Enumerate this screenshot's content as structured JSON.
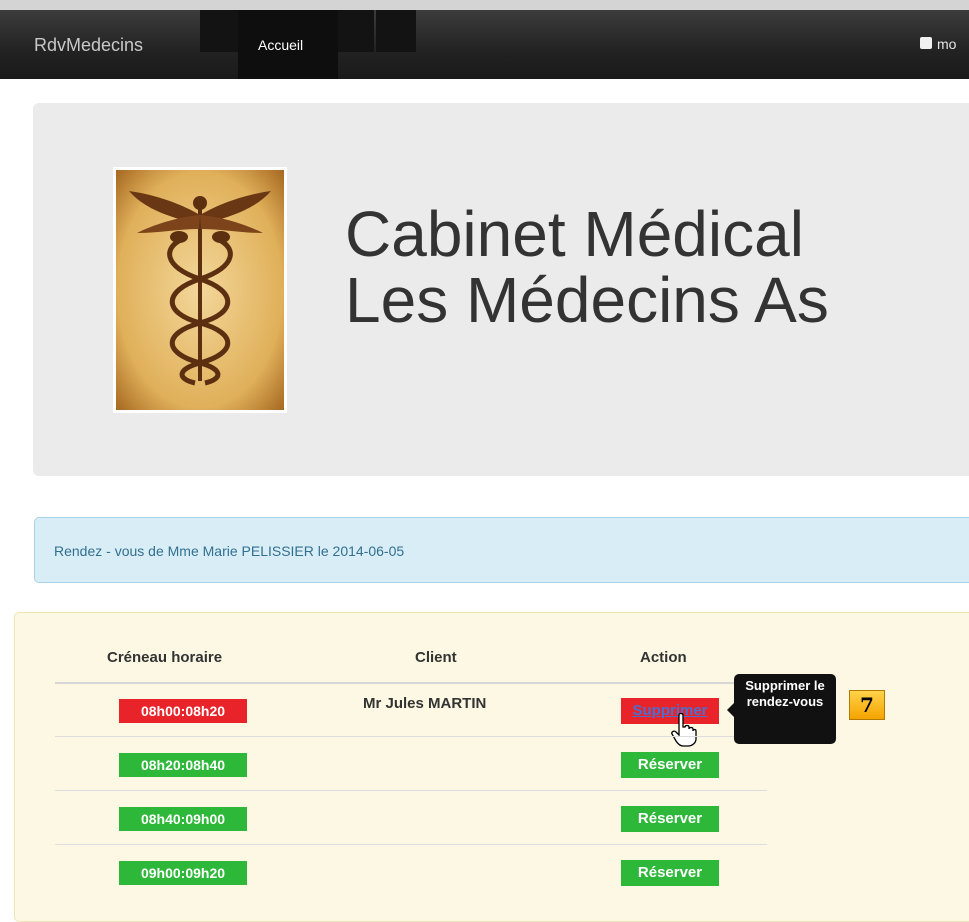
{
  "navbar": {
    "brand": "RdvMedecins",
    "nav_label": "Accueil",
    "right_text": "mo"
  },
  "jumbotron": {
    "title_line1": "Cabinet Médical",
    "title_line2": "Les Médecins As",
    "logo_icon": "caduceus-icon"
  },
  "alert": {
    "text": "Rendez - vous de Mme Marie PELISSIER le 2014-06-05"
  },
  "table": {
    "headers": [
      "Créneau horaire",
      "Client",
      "Action"
    ],
    "rows": [
      {
        "slot": "08h00:08h20",
        "client": "Mr Jules MARTIN",
        "action": "Supprimer",
        "status": "booked"
      },
      {
        "slot": "08h20:08h40",
        "client": "",
        "action": "Réserver",
        "status": "free"
      },
      {
        "slot": "08h40:09h00",
        "client": "",
        "action": "Réserver",
        "status": "free"
      },
      {
        "slot": "09h00:09h20",
        "client": "",
        "action": "Réserver",
        "status": "free"
      }
    ]
  },
  "tooltip": {
    "text": "Supprimer le rendez-vous"
  },
  "badge": {
    "number": "7"
  },
  "colors": {
    "booked": "#e8242a",
    "free": "#2eb83a",
    "alert_bg": "#d9edf7",
    "panel_bg": "#fcf8e3"
  }
}
